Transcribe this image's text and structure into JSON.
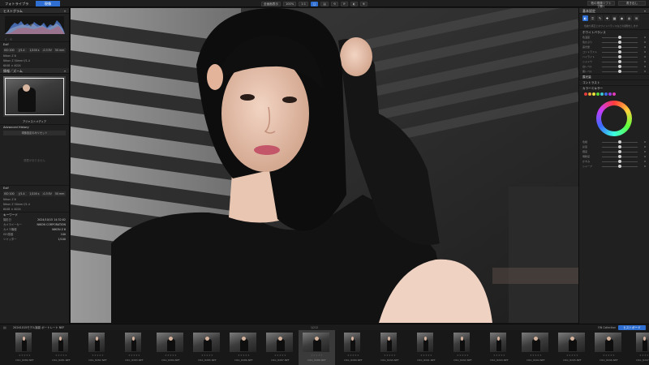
{
  "topbar": {
    "tab_library": "フォトライブラリ",
    "tab_develop": "現像",
    "tools": [
      "全画面表示",
      "100%",
      "1:1",
      "□",
      "▤",
      "⟲",
      "⟳",
      "◐",
      "⊕"
    ],
    "right_buttons": [
      "他の現像ソフトで開く",
      "書き出し"
    ]
  },
  "left": {
    "histogram_header": "ヒストグラム",
    "exif_header": "Exif",
    "exif_values": [
      "ISO 100",
      "ƒ/1.4",
      "1/100 s",
      "-0.3 EV",
      "50 mm"
    ],
    "camera": "Nikon Z 6",
    "lens": "Nikon Z 50mm f/1.4",
    "size": "6048 × 4024",
    "navigator_header": "情報／ズーム",
    "preset_name": "アジャストメディア",
    "history_header": "Advanced History",
    "history_btn": "現像設定のみリセット",
    "empty_note": "履歴がありません",
    "exif2_header": "Exif",
    "keywords_header": "キーワード",
    "meta_labels": [
      "撮影日",
      "カメラメーカー",
      "カメラ機種",
      "ISO感度",
      "シャッター"
    ],
    "meta_values": [
      "2024/10/15 14:32:02",
      "NIKON CORPORATION",
      "NIKON Z 6",
      "100",
      "1/100"
    ]
  },
  "right": {
    "header": "基本設定",
    "note": "色被り補正とホワイトバランスなどの調整をします",
    "sections": [
      "ホワイトバランス",
      "露光量",
      "コントラスト",
      "ハイライト",
      "シャドウ"
    ],
    "sliders": [
      {
        "label": "色温度",
        "value": "0",
        "pos": 0.5
      },
      {
        "label": "色かぶり",
        "value": "0",
        "pos": 0.5
      },
      {
        "label": "露光量",
        "value": "0",
        "pos": 0.5
      },
      {
        "label": "コントラスト",
        "value": "0",
        "pos": 0.5
      },
      {
        "label": "ハイライト",
        "value": "0",
        "pos": 0.5
      },
      {
        "label": "シャドウ",
        "value": "0",
        "pos": 0.5
      },
      {
        "label": "白レベル",
        "value": "0",
        "pos": 0.5
      },
      {
        "label": "黒レベル",
        "value": "0",
        "pos": 0.5
      }
    ],
    "hsl_header": "カラーミキサー",
    "swatch_colors": [
      "#e23b3b",
      "#e8a33b",
      "#e8e23b",
      "#58d43b",
      "#3bc7d4",
      "#3b6be2",
      "#9b3be2",
      "#e23bb8"
    ],
    "lower_sliders": [
      {
        "label": "色相",
        "value": "0",
        "pos": 0.5
      },
      {
        "label": "彩度",
        "value": "0",
        "pos": 0.5
      },
      {
        "label": "輝度",
        "value": "0",
        "pos": 0.5
      },
      {
        "label": "明瞭度",
        "value": "0",
        "pos": 0.5
      },
      {
        "label": "かすみ",
        "value": "0",
        "pos": 0.5
      },
      {
        "label": "シャープ",
        "value": "0",
        "pos": 0.5
      }
    ]
  },
  "filmstrip": {
    "path": "20241015モデル撮影 ポートレート NEF",
    "count": "1/212",
    "right_label": "Y/N Collection",
    "right_button": "ヒストボード",
    "thumbs": [
      {
        "name": "DSC_8280.NEF",
        "portrait": true
      },
      {
        "name": "DSC_8281.NEF",
        "portrait": true
      },
      {
        "name": "DSC_8282.NEF",
        "portrait": true
      },
      {
        "name": "DSC_8283.NEF",
        "portrait": true
      },
      {
        "name": "DSC_8284.NEF",
        "portrait": false
      },
      {
        "name": "DSC_8285.NEF",
        "portrait": false
      },
      {
        "name": "DSC_8286.NEF",
        "portrait": false
      },
      {
        "name": "DSC_8287.NEF",
        "portrait": false
      },
      {
        "name": "DSC_8288.NEF",
        "portrait": false,
        "selected": true
      },
      {
        "name": "DSC_8289.NEF",
        "portrait": true
      },
      {
        "name": "DSC_8290.NEF",
        "portrait": true
      },
      {
        "name": "DSC_8291.NEF",
        "portrait": true
      },
      {
        "name": "DSC_8292.NEF",
        "portrait": true
      },
      {
        "name": "DSC_8293.NEF",
        "portrait": true
      },
      {
        "name": "DSC_8294.NEF",
        "portrait": false
      },
      {
        "name": "DSC_8295.NEF",
        "portrait": false
      },
      {
        "name": "DSC_8296.NEF",
        "portrait": false
      },
      {
        "name": "DSC_8297.NEF",
        "portrait": true
      }
    ]
  }
}
